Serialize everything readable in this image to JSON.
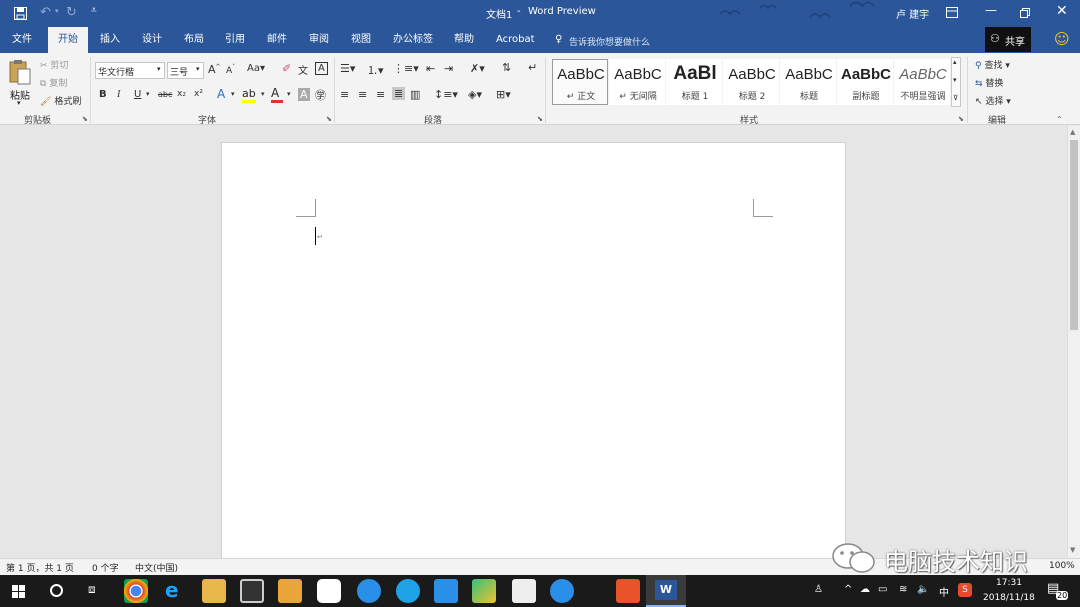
{
  "titlebar": {
    "save_icon": "save-icon",
    "undo_icon": "undo-icon",
    "redo_icon": "redo-icon",
    "doc_title": "文档1",
    "separator": "-",
    "app_name": "Word Preview",
    "user_name": "卢 建宇",
    "accent": "#2b579a"
  },
  "tabs": [
    {
      "label": "文件"
    },
    {
      "label": "开始"
    },
    {
      "label": "插入"
    },
    {
      "label": "设计"
    },
    {
      "label": "布局"
    },
    {
      "label": "引用"
    },
    {
      "label": "邮件"
    },
    {
      "label": "审阅"
    },
    {
      "label": "视图"
    },
    {
      "label": "办公标签"
    },
    {
      "label": "帮助"
    },
    {
      "label": "Acrobat"
    }
  ],
  "tellme": "告诉我你想要做什么",
  "share": "共享",
  "clipboard": {
    "paste": "粘贴",
    "cut": "剪切",
    "copy": "复制",
    "format_painter": "格式刷",
    "group": "剪贴板"
  },
  "font": {
    "name": "华文行楷",
    "size": "三号",
    "bold": "B",
    "italic": "I",
    "underline": "U",
    "strike": "abc",
    "subscript": "x₂",
    "superscript": "x²",
    "group": "字体"
  },
  "paragraph": {
    "group": "段落"
  },
  "styles": {
    "group": "样式",
    "items": [
      {
        "preview": "AaBbC",
        "name": "正文"
      },
      {
        "preview": "AaBbC",
        "name": "无间隔"
      },
      {
        "preview": "AaBl",
        "name": "标题 1"
      },
      {
        "preview": "AaBbC",
        "name": "标题 2"
      },
      {
        "preview": "AaBbC",
        "name": "标题"
      },
      {
        "preview": "AaBbC",
        "name": "副标题"
      },
      {
        "preview": "AaBbC",
        "name": "不明显强调"
      }
    ]
  },
  "editing": {
    "find": "查找",
    "replace": "替换",
    "select": "选择",
    "group": "编辑"
  },
  "status": {
    "page": "第 1 页，共 1 页",
    "words": "0 个字",
    "lang": "中文(中国)",
    "zoom": "100%"
  },
  "watermark": "电脑技术知识",
  "taskbar": {
    "time": "17:31",
    "date": "2018/11/18",
    "ime": "中",
    "notif_count": "20"
  }
}
